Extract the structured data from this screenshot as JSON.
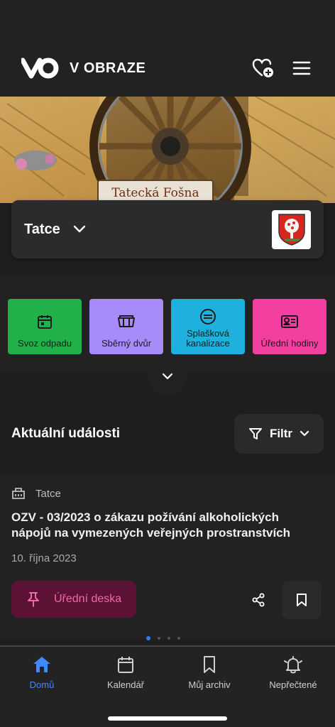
{
  "header": {
    "brand": "V OBRAZE"
  },
  "hero": {
    "sign_text": "Tatecká Fošna"
  },
  "town": {
    "name": "Tatce"
  },
  "tiles": [
    {
      "label": "Svoz odpadu",
      "color": "#22b04b"
    },
    {
      "label": "Sběrný dvůr",
      "color": "#a78bfa"
    },
    {
      "label": "Splašková kanalizace",
      "color": "#1eb1dd"
    },
    {
      "label": "Úřední hodiny",
      "color": "#f23fa0"
    }
  ],
  "events": {
    "title": "Aktuální události",
    "filter_label": "Filtr",
    "item": {
      "source": "Tatce",
      "title": "OZV - 03/2023 o zákazu požívání alkoholických nápojů na vymezených veřejných prostranstvích",
      "date": "10. října 2023",
      "tag": "Úřední deska"
    },
    "pagination": {
      "count": 4,
      "active": 1
    }
  },
  "nav": {
    "items": [
      {
        "label": "Domů",
        "icon": "home-icon",
        "active": true
      },
      {
        "label": "Kalendář",
        "icon": "calendar-icon"
      },
      {
        "label": "Můj archiv",
        "icon": "bookmark-icon"
      },
      {
        "label": "Nepřečtené",
        "icon": "bell-icon"
      }
    ]
  },
  "colors": {
    "accent": "#3d8bfd",
    "tag_bg": "#5b1235",
    "tag_fg": "#ef6aa8",
    "background": "#1e1e1e"
  }
}
